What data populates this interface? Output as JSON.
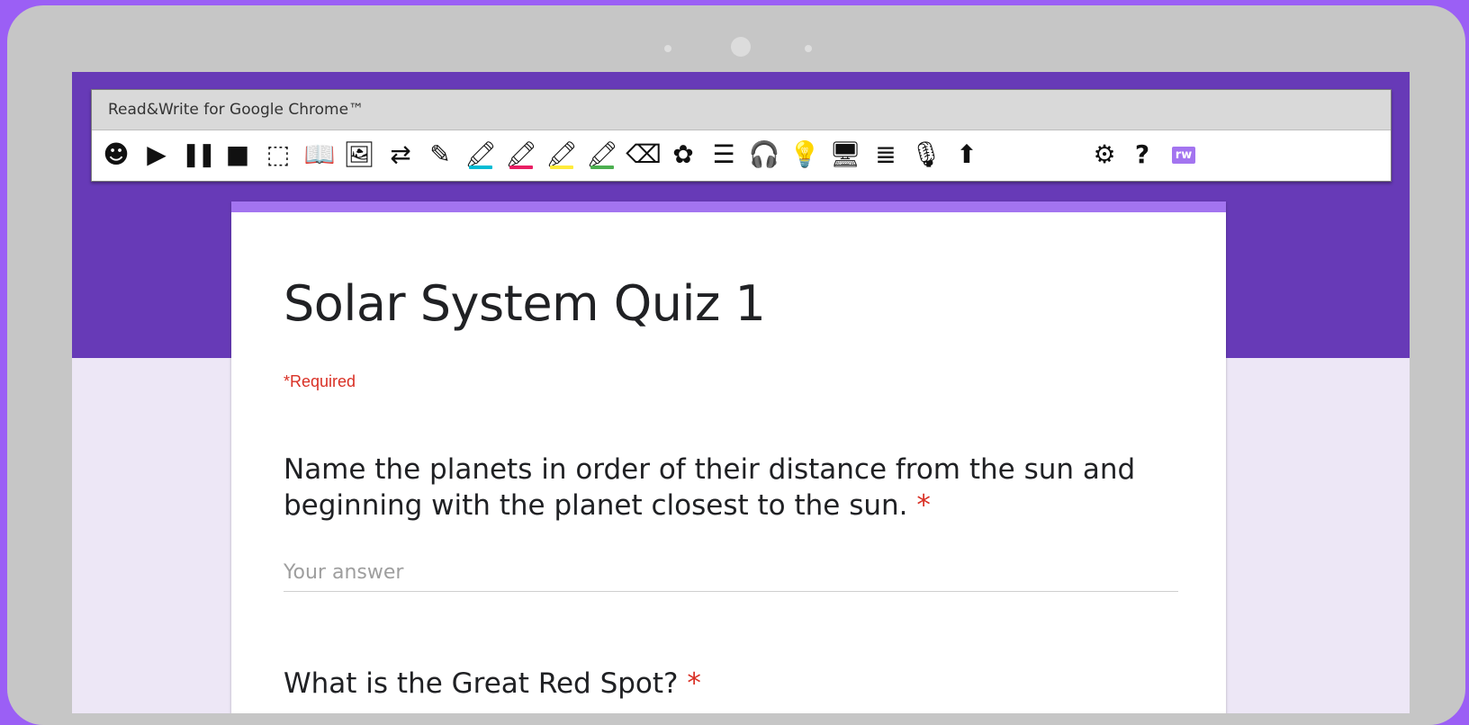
{
  "extension": {
    "title": "Read&Write for Google Chrome™",
    "tools": [
      {
        "name": "hover-speech-icon",
        "glyph": "☻"
      },
      {
        "name": "play-icon",
        "glyph": "▶"
      },
      {
        "name": "pause-icon",
        "glyph": "❚❚"
      },
      {
        "name": "stop-icon",
        "glyph": "■"
      },
      {
        "name": "screenshot-reader-icon",
        "glyph": "⬚"
      },
      {
        "name": "dictionary-icon",
        "glyph": "📖"
      },
      {
        "name": "picture-dictionary-icon",
        "glyph": "🖼"
      },
      {
        "name": "translator-icon",
        "glyph": "⇄"
      },
      {
        "name": "check-it-icon",
        "glyph": "✎"
      },
      {
        "name": "highlight-blue-icon",
        "glyph": "🖍",
        "color": "#00bcd4"
      },
      {
        "name": "highlight-pink-icon",
        "glyph": "🖍",
        "color": "#e91e63"
      },
      {
        "name": "highlight-yellow-icon",
        "glyph": "🖍",
        "color": "#ffeb3b"
      },
      {
        "name": "highlight-green-icon",
        "glyph": "🖍",
        "color": "#4caf50"
      },
      {
        "name": "clear-highlights-icon",
        "glyph": "⌫"
      },
      {
        "name": "collect-highlights-icon",
        "glyph": "✿"
      },
      {
        "name": "vocabulary-list-icon",
        "glyph": "☰"
      },
      {
        "name": "talk-and-type-icon",
        "glyph": "🎧"
      },
      {
        "name": "voice-note-icon",
        "glyph": "💡"
      },
      {
        "name": "simplify-page-icon",
        "glyph": "🖥"
      },
      {
        "name": "rewordify-icon",
        "glyph": "≣"
      },
      {
        "name": "audio-maker-icon",
        "glyph": "🎙"
      },
      {
        "name": "practice-reading-icon",
        "glyph": "⬆"
      },
      {
        "name": "settings-icon",
        "glyph": "⚙"
      },
      {
        "name": "help-icon",
        "glyph": "?"
      },
      {
        "name": "rw-extension-icon",
        "glyph": "rw",
        "color": "#a374f0"
      }
    ]
  },
  "form": {
    "title": "Solar System Quiz 1",
    "required_note": "*Required",
    "questions": [
      {
        "text": "Name the planets in order of their distance from the sun and beginning with the planet closest to the sun.",
        "required_mark": "*",
        "answer_placeholder": "Your answer"
      },
      {
        "text": "What is the Great Red Spot?",
        "required_mark": "*"
      }
    ]
  },
  "colors": {
    "header": "#673ab7",
    "card_accent": "#a374f0",
    "page_bg": "#ede7f6",
    "required": "#d93025"
  }
}
